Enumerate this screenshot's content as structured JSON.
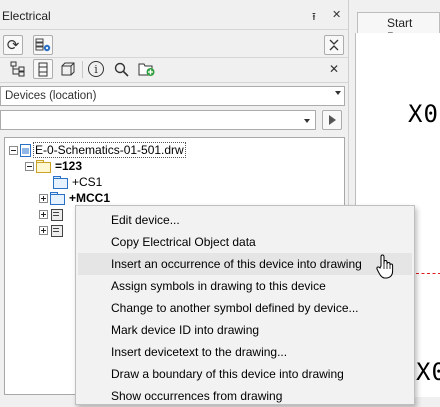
{
  "panel": {
    "title": "Electrical",
    "pin_glyph": "⭱",
    "close_glyph": "✕"
  },
  "toolbar1": {
    "refresh_glyph": "⟳",
    "collapse_glyph": "≈"
  },
  "toolbar2": {
    "info_glyph": "i",
    "search_glyph": "⌕",
    "close_glyph": "✕"
  },
  "view_select": {
    "value": "Devices (location)"
  },
  "filter_input": {
    "value": ""
  },
  "tree": {
    "root": "E-0-Schematics-01-501.drw",
    "location": "=123",
    "children": [
      "+CS1",
      "+MCC1"
    ]
  },
  "document": {
    "tab_label": "Start Page",
    "canvas_text_1": "X0",
    "canvas_text_2": "X0"
  },
  "context_menu": {
    "highlighted_index": 2,
    "items": [
      "Edit device...",
      "Copy Electrical Object data",
      "Insert an occurrence of this device into drawing",
      "Assign symbols in drawing to this device",
      "Change to another symbol defined by device...",
      "Mark device ID into drawing",
      "Insert devicetext to the drawing...",
      "Draw a boundary of this device into drawing",
      "Show occurrences from drawing"
    ]
  },
  "colors": {
    "accent_blue": "#2a72c8",
    "add_green": "#2e9e3e",
    "cross_line_red": "#e02020"
  }
}
